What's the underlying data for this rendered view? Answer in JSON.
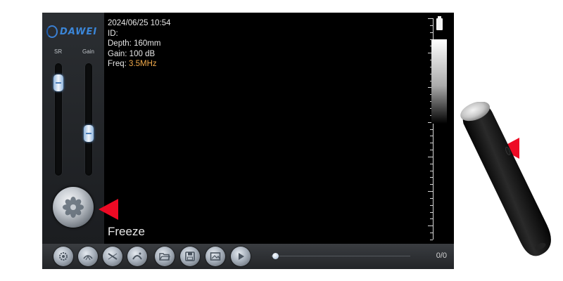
{
  "device": {
    "brand": "DAWEI",
    "datetime": "2024/06/25 10:54",
    "id_label": "ID:",
    "depth": "Depth: 160mm",
    "gain": "Gain: 100 dB",
    "freq_label": "Freq:",
    "freq_value": "3.5MHz",
    "freeze_label": "Freeze",
    "counter": "0/0"
  },
  "sliders": [
    {
      "label": "SR",
      "level": 0.88
    },
    {
      "label": "Gain",
      "level": 0.35
    }
  ],
  "toolbar": {
    "icons": [
      "settings-icon",
      "probe-mode-icon",
      "linear-probe-icon",
      "convex-probe-icon",
      "open-folder-icon",
      "save-icon",
      "image-icon",
      "play-icon"
    ],
    "playback_progress": 0.0
  },
  "colors": {
    "freq_value": "#f0a94a",
    "brand": "#3b86d8",
    "pointer": "#ee0a24",
    "screen_bg": "#000000"
  }
}
